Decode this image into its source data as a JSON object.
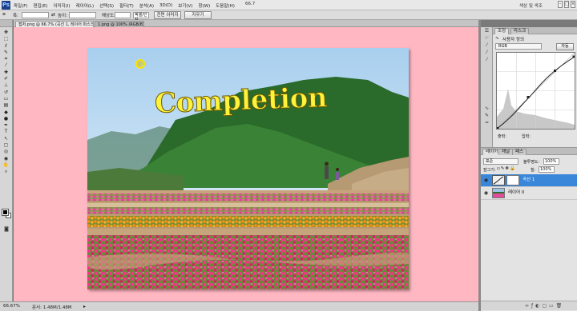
{
  "app": {
    "logo": "Ps",
    "menu": [
      "파일(F)",
      "편집(E)",
      "이미지(I)",
      "레이어(L)",
      "선택(S)",
      "필터(T)",
      "분석(A)",
      "3D(D)",
      "보기(V)",
      "창(W)",
      "도움말(H)"
    ],
    "zoom": "66.7",
    "workspace": "색상 및 색조"
  },
  "options": {
    "width_label": "폭:",
    "height_label": "높이:",
    "resolution_label": "해상도:",
    "resolution_unit": "픽셀/인치",
    "front_image_button": "전면 이미지",
    "clear_button": "지우기"
  },
  "document": {
    "tabs": [
      "캡처.png @ 66.7% (곡선 1, 레이어 마스크/8) * ×",
      "1.png @ 100% (RGB/8) ×"
    ],
    "overlay_text": "@ Completion"
  },
  "status": {
    "zoom": "66.67%",
    "doc_size": "문서: 1.48M/1.48M"
  },
  "curves_panel": {
    "tabs": [
      "조정",
      "마스크"
    ],
    "preset_label": "사용자 정의",
    "channel": "RGB",
    "auto_button": "자동",
    "output_label": "출력:",
    "input_label": "입력:"
  },
  "layers_panel": {
    "tabs": [
      "레이어",
      "채널",
      "패스"
    ],
    "blend_mode": "표준",
    "opacity_label": "불투명도:",
    "opacity_value": "100%",
    "lock_label": "잠그기:",
    "fill_label": "칠:",
    "fill_value": "100%",
    "layers": [
      {
        "name": "곡선 1",
        "selected": true
      },
      {
        "name": "레이어 0",
        "selected": false
      }
    ]
  },
  "colors": {
    "canvas_bg": "#ffb7c2",
    "selection": "#3a86d8",
    "title_yellow": "#fff23a"
  }
}
